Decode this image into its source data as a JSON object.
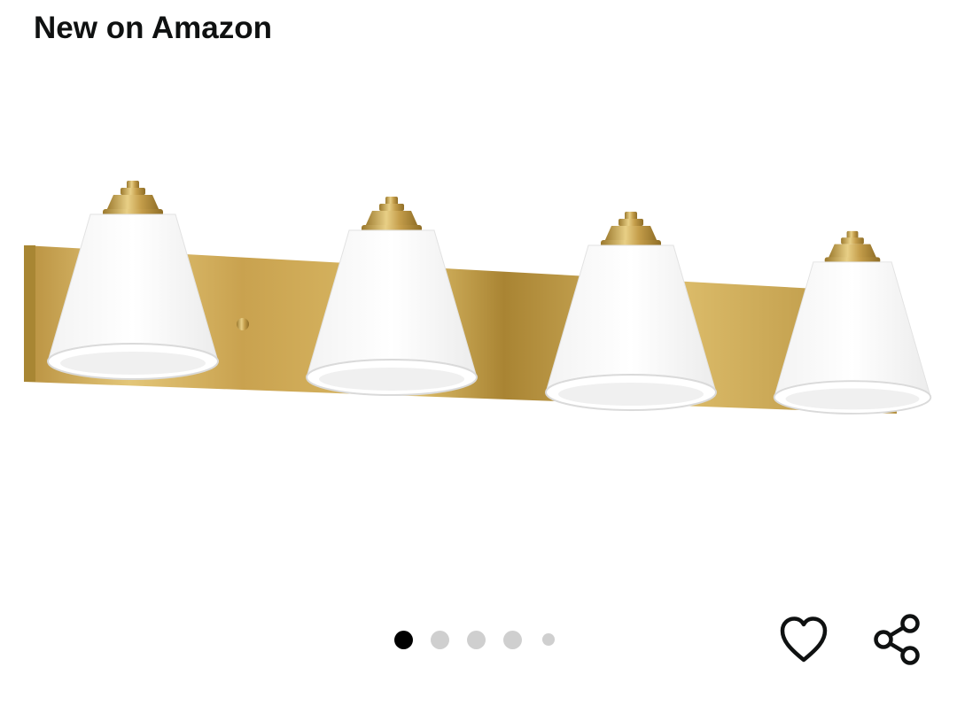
{
  "section": {
    "title": "New on Amazon"
  },
  "product": {
    "image_icon": "vanity-light-fixture-image",
    "fixture_color": "#c9a54f",
    "shade_color": "#ffffff"
  },
  "carousel": {
    "page_count": 5,
    "current_page": 1,
    "active_color": "#000000",
    "inactive_color": "#cfcfcf"
  },
  "actions": {
    "like_icon": "heart-outline-icon",
    "share_icon": "share-icon",
    "icon_color": "#0f1111"
  }
}
